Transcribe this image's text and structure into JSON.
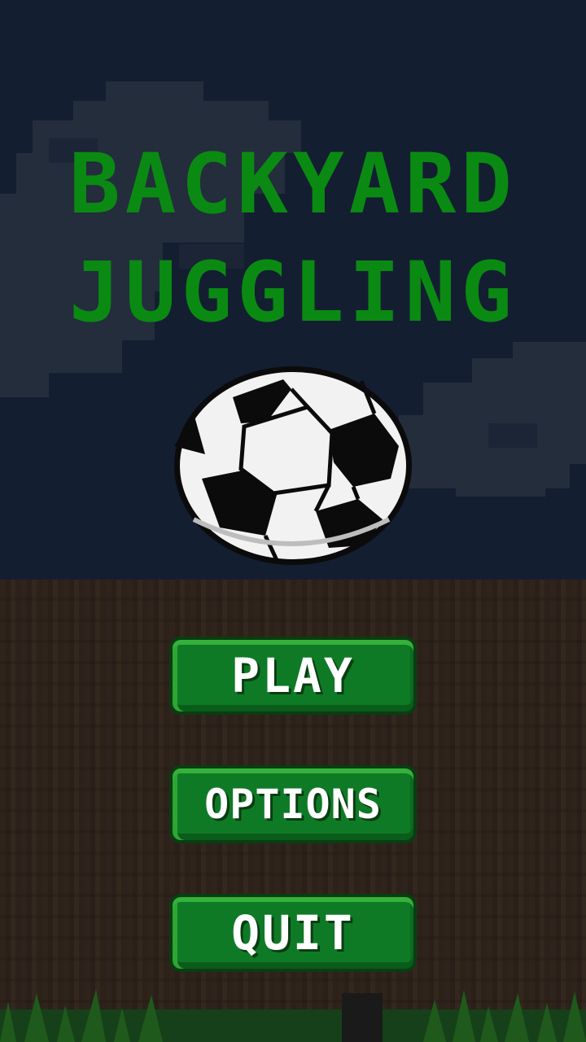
{
  "game": {
    "title_line_1": "BACKYARD",
    "title_line_2": "JUGGLING"
  },
  "menu": {
    "play_label": "PLAY",
    "options_label": "OPTIONS",
    "quit_label": "QUIT"
  },
  "colors": {
    "sky": "#141e31",
    "cloud": "#26303f",
    "title_green": "#0a8a12",
    "button_green": "#0f7a26",
    "dirt": "#2f241c",
    "grass": "#1f5a1c"
  },
  "icons": {
    "ball": "soccer-ball-icon"
  }
}
